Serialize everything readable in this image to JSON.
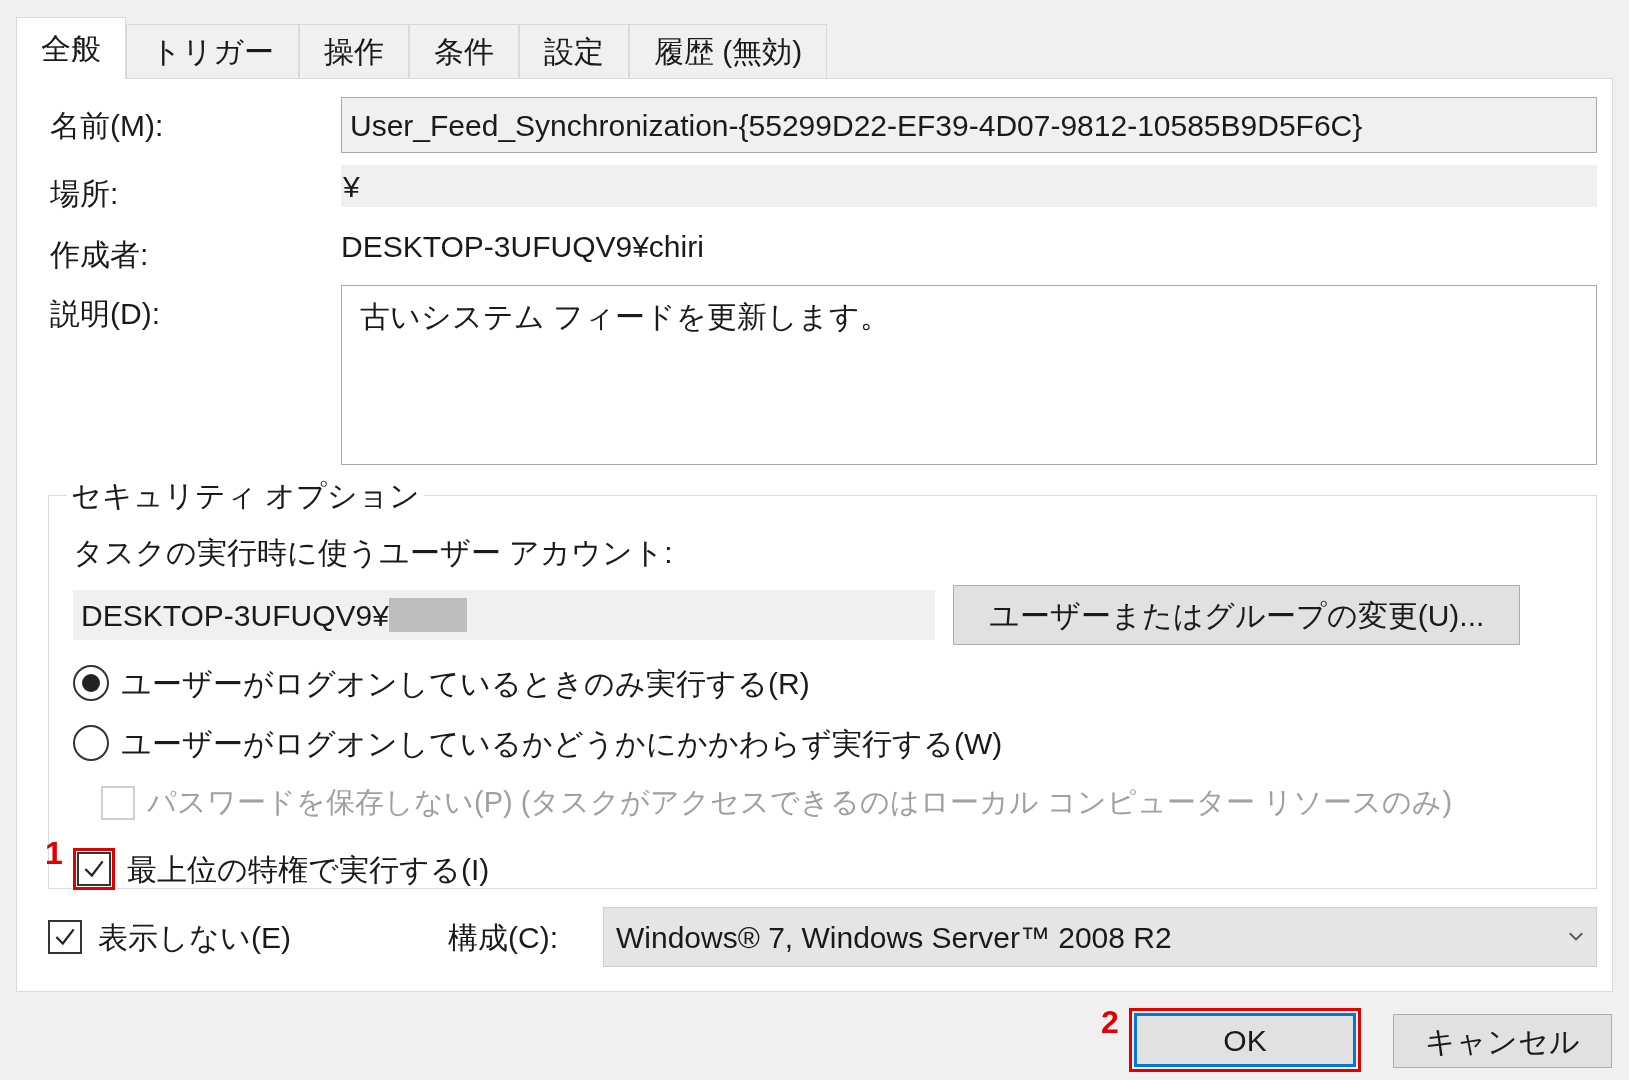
{
  "tabs": [
    {
      "label": "全般",
      "selected": true
    },
    {
      "label": "トリガー",
      "selected": false
    },
    {
      "label": "操作",
      "selected": false
    },
    {
      "label": "条件",
      "selected": false
    },
    {
      "label": "設定",
      "selected": false
    },
    {
      "label": "履歴 (無効)",
      "selected": false
    }
  ],
  "fields": [
    {
      "kind": "input",
      "label": "名前(M):",
      "value": "User_Feed_Synchronization-{55299D22-EF39-4D07-9812-10585B9D5F6C}"
    },
    {
      "kind": "readonly",
      "label": "場所:",
      "value": "¥"
    },
    {
      "kind": "text",
      "label": "作成者:",
      "value": "DESKTOP-3UFUQV9¥chiri"
    },
    {
      "kind": "textarea",
      "label": "説明(D):",
      "value": "古いシステム フィードを更新します。"
    }
  ],
  "security": {
    "title": "セキュリティ オプション",
    "account_label": "タスクの実行時に使うユーザー アカウント:",
    "account_value": "DESKTOP-3UFUQV9¥",
    "account_redacted": true,
    "change_button": "ユーザーまたはグループの変更(U)...",
    "options": [
      {
        "kind": "radio",
        "label": "ユーザーがログオンしているときのみ実行する(R)",
        "selected": true
      },
      {
        "kind": "radio",
        "label": "ユーザーがログオンしているかどうかにかかわらず実行する(W)",
        "selected": false
      },
      {
        "kind": "sub_checkbox",
        "label": "パスワードを保存しない(P) (タスクがアクセスできるのはローカル コンピューター リソースのみ)",
        "checked": false,
        "disabled": true
      },
      {
        "kind": "checkbox",
        "label": "最上位の特権で実行する(I)",
        "checked": true,
        "disabled": false,
        "callout": "1"
      }
    ]
  },
  "hidden": {
    "label": "表示しない(E)",
    "checked": true
  },
  "config": {
    "label": "構成(C):",
    "value": "Windows® 7, Windows Server™ 2008 R2"
  },
  "buttons": [
    {
      "label": "OK",
      "default": true,
      "callout": "2"
    },
    {
      "label": "キャンセル",
      "default": false
    }
  ]
}
